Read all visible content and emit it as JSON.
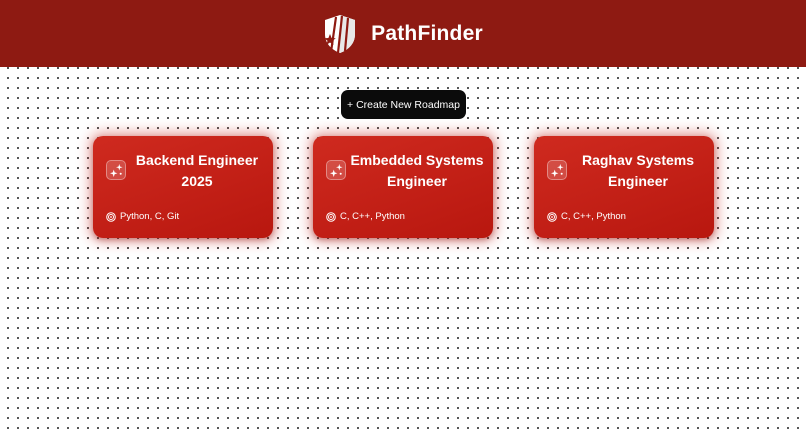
{
  "app": {
    "name": "PathFinder",
    "logo_icon": "shield-star-logo-icon"
  },
  "toolbar": {
    "create_label": "+ Create New Roadmap"
  },
  "roadmaps": [
    {
      "title": "Backend Engineer 2025",
      "skills": "Python, C, Git",
      "icon": "sparkles-icon"
    },
    {
      "title": "Embedded Systems Engineer",
      "skills": "C, C++, Python",
      "icon": "sparkles-icon"
    },
    {
      "title": "Raghav Systems Engineer",
      "skills": "C, C++, Python",
      "icon": "sparkles-icon"
    }
  ],
  "colors": {
    "header_bg": "#8e1a12",
    "card_bg": "#c21f16",
    "button_bg": "#0b0b0b",
    "text_light": "#ffffff"
  }
}
